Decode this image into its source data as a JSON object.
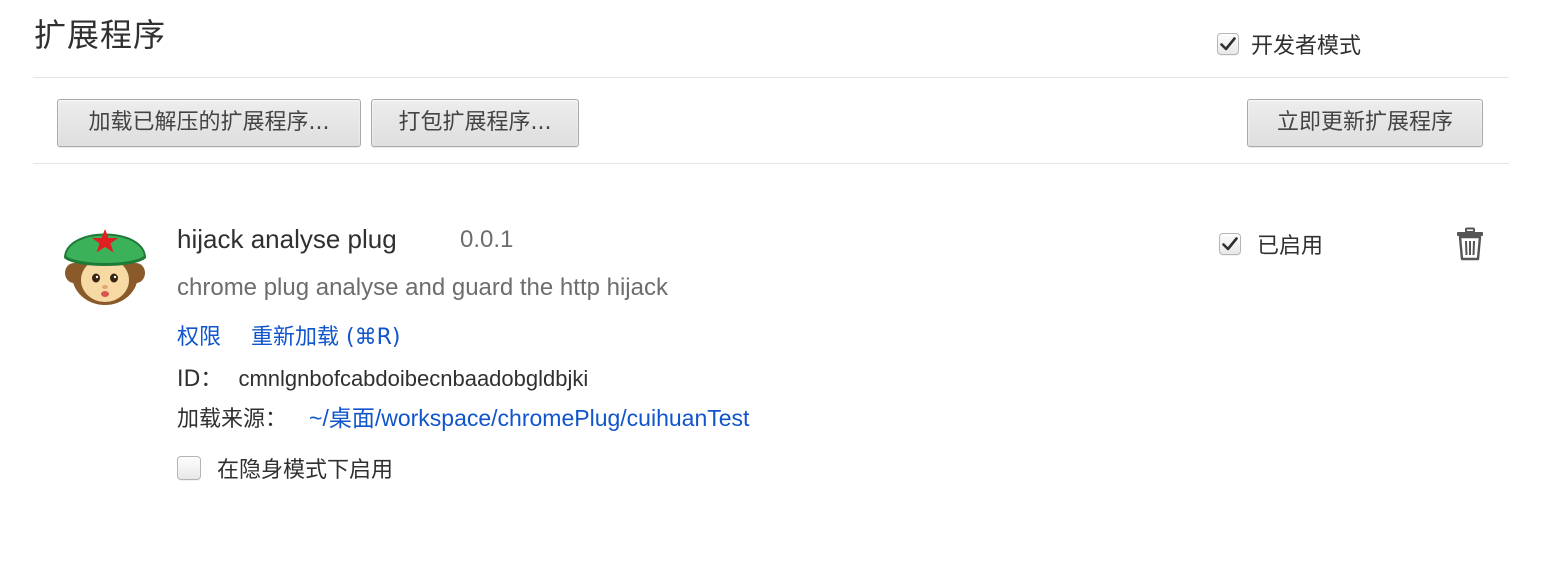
{
  "header": {
    "title": "扩展程序",
    "developer_mode": {
      "label": "开发者模式",
      "checked": true
    }
  },
  "toolbar": {
    "load_unpacked_label": "加载已解压的扩展程序...",
    "pack_label": "打包扩展程序...",
    "update_now_label": "立即更新扩展程序"
  },
  "extension": {
    "icon": "monchhichi-green-cap-icon",
    "name": "hijack analyse plug",
    "version": "0.0.1",
    "description": "chrome plug analyse and guard the http hijack",
    "permissions_label": "权限",
    "reload_label": "重新加载 (⌘R)",
    "id_label": "ID：",
    "id_value": "cmnlgnbofcabdoibecnbaadobgldbjki",
    "source_label": "加载来源：",
    "source_path": "~/桌面/workspace/chromePlug/cuihuanTest",
    "incognito_label": "在隐身模式下启用",
    "incognito_checked": false,
    "enabled_label": "已启用",
    "enabled_checked": true
  },
  "colors": {
    "link": "#1155cc",
    "text": "#303030",
    "muted": "#6d6d6d",
    "divider": "#e5e5e5"
  }
}
